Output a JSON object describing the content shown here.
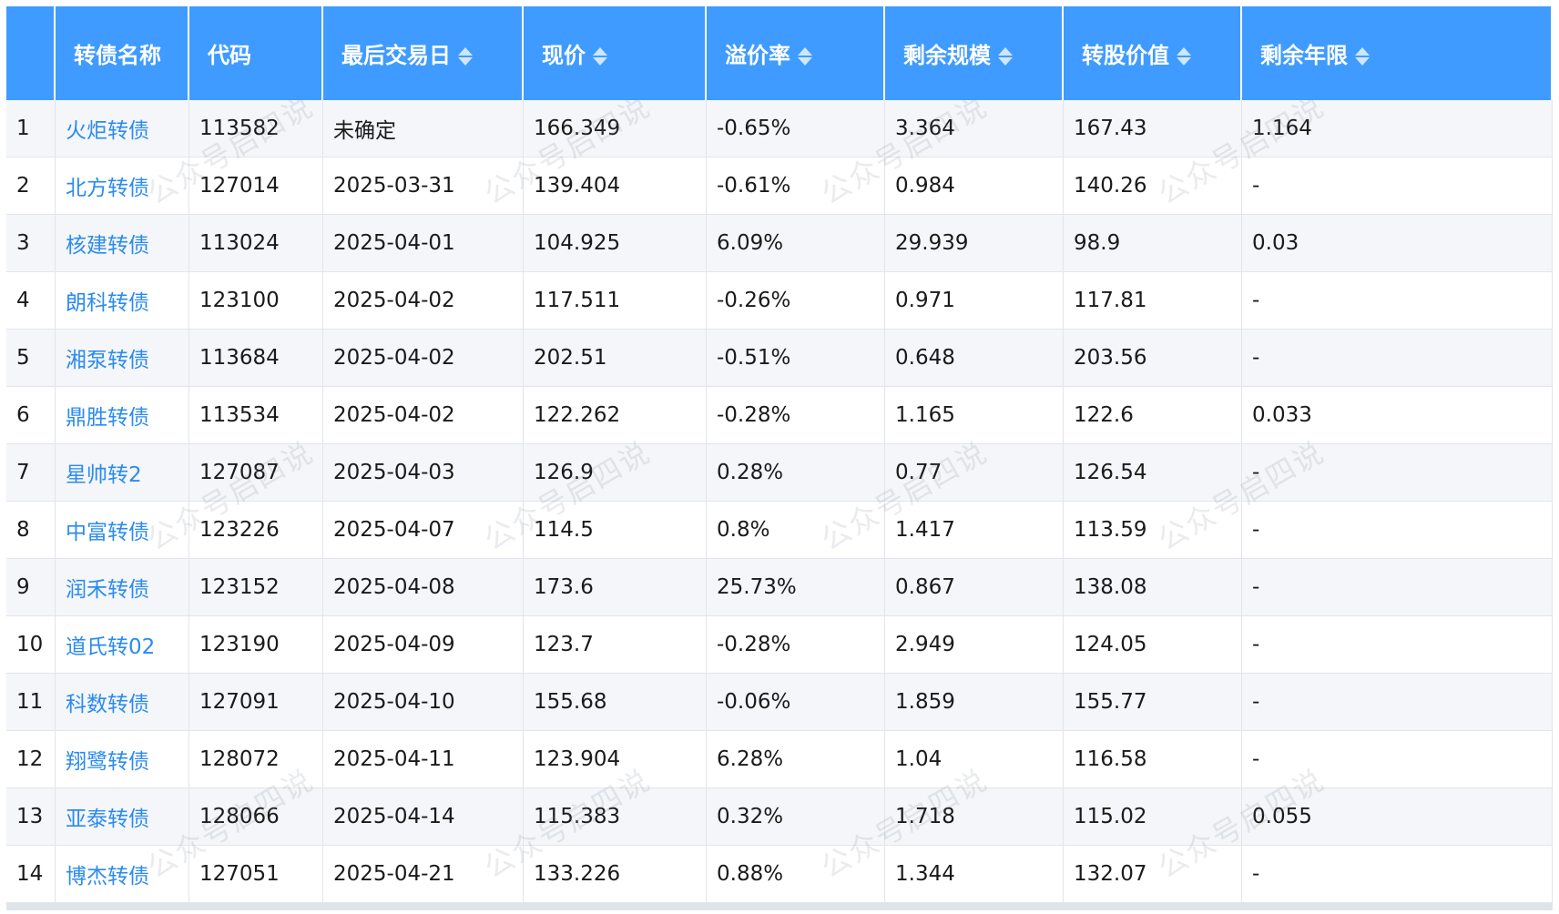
{
  "table": {
    "headers": [
      {
        "label": "",
        "sortable": false
      },
      {
        "label": "转债名称",
        "sortable": false
      },
      {
        "label": "代码",
        "sortable": false
      },
      {
        "label": "最后交易日",
        "sortable": true
      },
      {
        "label": "现价",
        "sortable": true
      },
      {
        "label": "溢价率",
        "sortable": true
      },
      {
        "label": "剩余规模",
        "sortable": true
      },
      {
        "label": "转股价值",
        "sortable": true
      },
      {
        "label": "剩余年限",
        "sortable": true
      }
    ],
    "rows": [
      [
        "1",
        "火炬转债",
        "113582",
        "未确定",
        "166.349",
        "-0.65%",
        "3.364",
        "167.43",
        "1.164"
      ],
      [
        "2",
        "北方转债",
        "127014",
        "2025-03-31",
        "139.404",
        "-0.61%",
        "0.984",
        "140.26",
        "-"
      ],
      [
        "3",
        "核建转债",
        "113024",
        "2025-04-01",
        "104.925",
        "6.09%",
        "29.939",
        "98.9",
        "0.03"
      ],
      [
        "4",
        "朗科转债",
        "123100",
        "2025-04-02",
        "117.511",
        "-0.26%",
        "0.971",
        "117.81",
        "-"
      ],
      [
        "5",
        "湘泵转债",
        "113684",
        "2025-04-02",
        "202.51",
        "-0.51%",
        "0.648",
        "203.56",
        "-"
      ],
      [
        "6",
        "鼎胜转债",
        "113534",
        "2025-04-02",
        "122.262",
        "-0.28%",
        "1.165",
        "122.6",
        "0.033"
      ],
      [
        "7",
        "星帅转2",
        "127087",
        "2025-04-03",
        "126.9",
        "0.28%",
        "0.77",
        "126.54",
        "-"
      ],
      [
        "8",
        "中富转债",
        "123226",
        "2025-04-07",
        "114.5",
        "0.8%",
        "1.417",
        "113.59",
        "-"
      ],
      [
        "9",
        "润禾转债",
        "123152",
        "2025-04-08",
        "173.6",
        "25.73%",
        "0.867",
        "138.08",
        "-"
      ],
      [
        "10",
        "道氏转02",
        "123190",
        "2025-04-09",
        "123.7",
        "-0.28%",
        "2.949",
        "124.05",
        "-"
      ],
      [
        "11",
        "科数转债",
        "127091",
        "2025-04-10",
        "155.68",
        "-0.06%",
        "1.859",
        "155.77",
        "-"
      ],
      [
        "12",
        "翔鹭转债",
        "128072",
        "2025-04-11",
        "123.904",
        "6.28%",
        "1.04",
        "116.58",
        "-"
      ],
      [
        "13",
        "亚泰转债",
        "128066",
        "2025-04-14",
        "115.383",
        "0.32%",
        "1.718",
        "115.02",
        "0.055"
      ],
      [
        "14",
        "博杰转债",
        "127051",
        "2025-04-21",
        "133.226",
        "0.88%",
        "1.344",
        "132.07",
        "-"
      ]
    ]
  },
  "watermark": "公众号启四说",
  "colors": {
    "header_bg": "#3f9bff",
    "link": "#2a8bf0",
    "row_alt": "#f4f6f9"
  },
  "icons": {
    "sort": "sort-caret-icon"
  }
}
